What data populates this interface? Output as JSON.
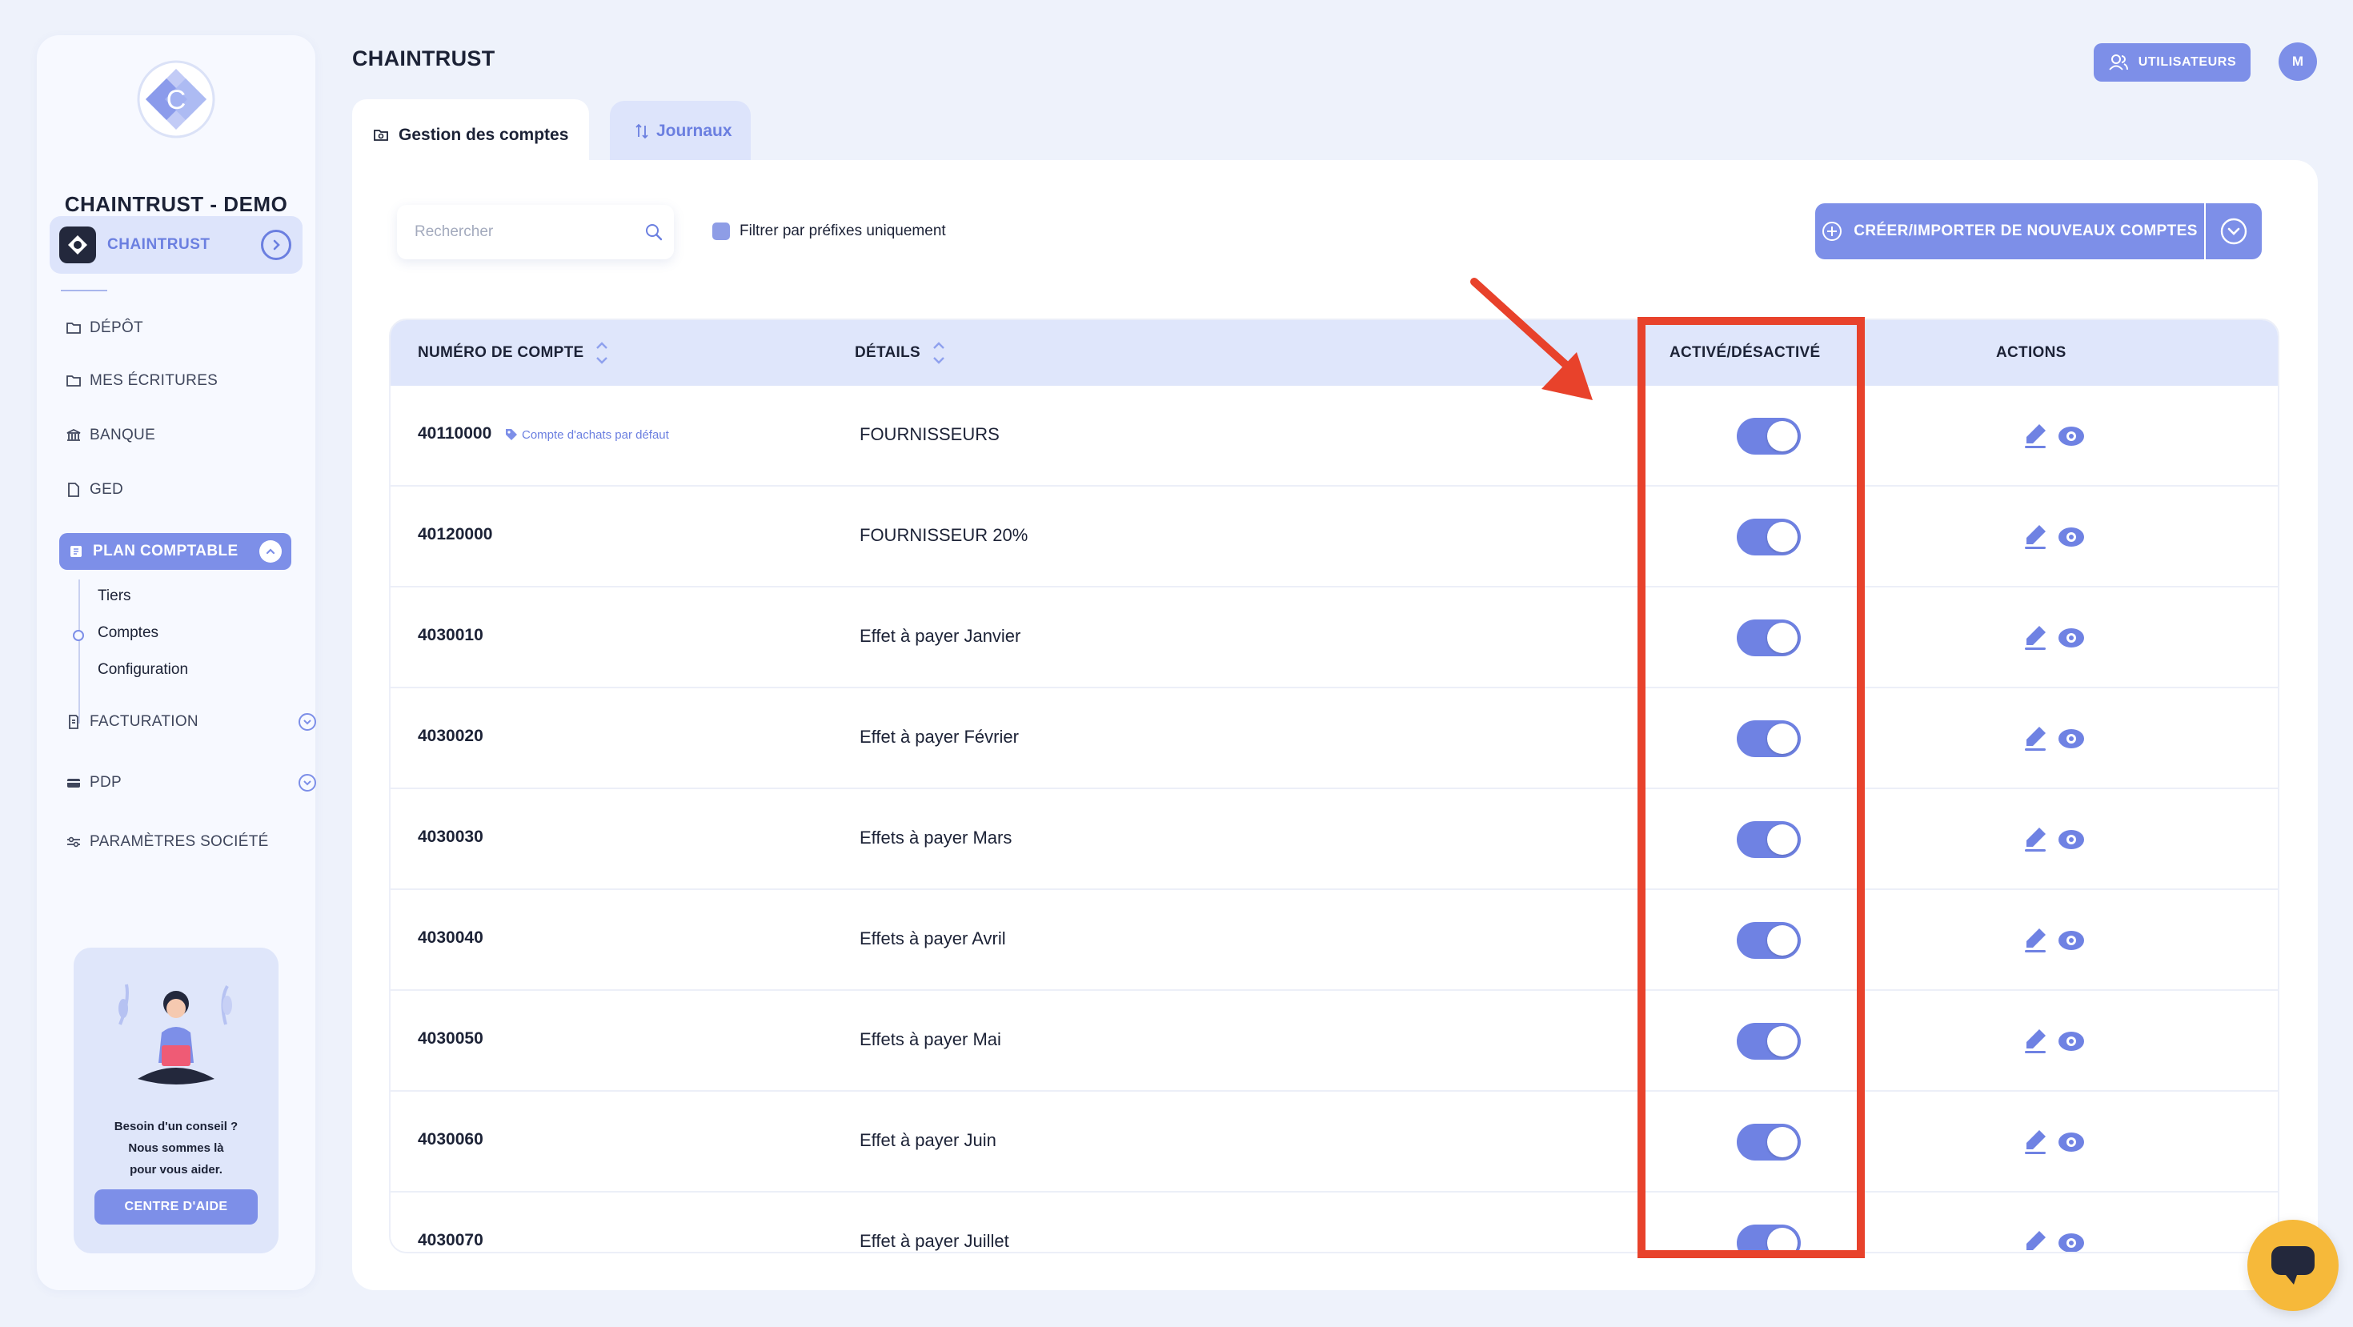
{
  "sidebar": {
    "company_name": "CHAINTRUST - DEMO",
    "org": {
      "label": "CHAINTRUST"
    },
    "nav": [
      {
        "label": "DÉPÔT",
        "icon": "folder-icon"
      },
      {
        "label": "MES ÉCRITURES",
        "icon": "folder-icon"
      },
      {
        "label": "BANQUE",
        "icon": "bank-icon"
      },
      {
        "label": "GED",
        "icon": "document-icon"
      }
    ],
    "active_section": {
      "label": "PLAN COMPTABLE",
      "icon": "ledger-icon"
    },
    "sub_items": [
      "Tiers",
      "Comptes",
      "Configuration"
    ],
    "nav_bottom": [
      {
        "label": "FACTURATION",
        "icon": "invoice-icon"
      },
      {
        "label": "PDP",
        "icon": "card-icon"
      },
      {
        "label": "PARAMÈTRES SOCIÉTÉ",
        "icon": "sliders-icon"
      }
    ],
    "help": {
      "line1": "Besoin d'un conseil ?",
      "line2": "Nous sommes là",
      "line3": "pour vous aider.",
      "button": "CENTRE D'AIDE"
    }
  },
  "header": {
    "title": "CHAINTRUST",
    "users_button": "UTILISATEURS",
    "avatar_initial": "M"
  },
  "tabs": [
    {
      "label": "Gestion des comptes",
      "active": true
    },
    {
      "label": "Journaux",
      "active": false
    }
  ],
  "toolbar": {
    "search_placeholder": "Rechercher",
    "search_value": "",
    "filter_label": "Filtrer par préfixes uniquement",
    "create_button": "CRÉER/IMPORTER DE NOUVEAUX COMPTES"
  },
  "table": {
    "headers": {
      "account": "NUMÉRO DE COMPTE",
      "details": "DÉTAILS",
      "active": "ACTIVÉ/DÉSACTIVÉ",
      "actions": "ACTIONS"
    },
    "rows": [
      {
        "number": "40110000",
        "badge": "Compte d'achats par défaut",
        "details": "FOURNISSEURS",
        "active": true
      },
      {
        "number": "40120000",
        "badge": "",
        "details": "FOURNISSEUR 20%",
        "active": true
      },
      {
        "number": "4030010",
        "badge": "",
        "details": "Effet à payer Janvier",
        "active": true
      },
      {
        "number": "4030020",
        "badge": "",
        "details": "Effet à payer Février",
        "active": true
      },
      {
        "number": "4030030",
        "badge": "",
        "details": "Effets à payer Mars",
        "active": true
      },
      {
        "number": "4030040",
        "badge": "",
        "details": "Effets à payer Avril",
        "active": true
      },
      {
        "number": "4030050",
        "badge": "",
        "details": "Effets à payer Mai",
        "active": true
      },
      {
        "number": "4030060",
        "badge": "",
        "details": "Effet à payer Juin",
        "active": true
      },
      {
        "number": "4030070",
        "badge": "",
        "details": "Effet à payer Juillet",
        "active": true
      }
    ]
  },
  "colors": {
    "accent": "#7d8fe8",
    "annotation": "#e8422b",
    "chat": "#f6b93a"
  }
}
